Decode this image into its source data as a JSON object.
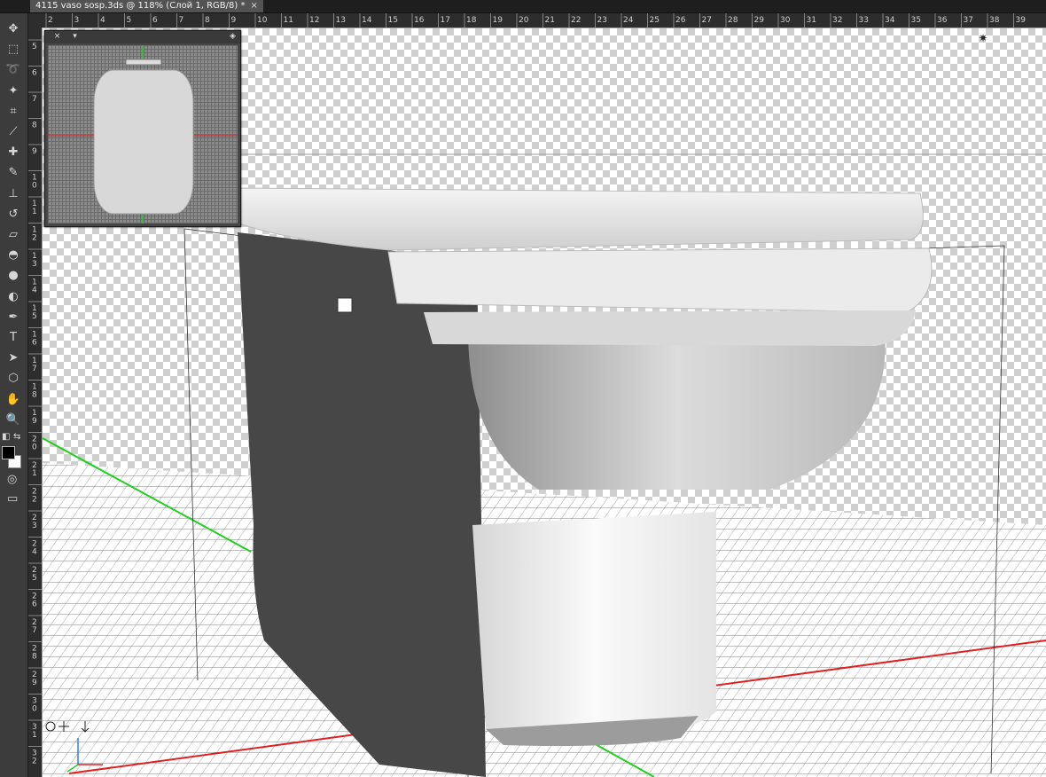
{
  "document": {
    "tab_title": "4115 vaso sosp.3ds @ 118% (Слой 1, RGB/8) *",
    "close_glyph": "×"
  },
  "ruler_top": {
    "ticks": [
      "2",
      "3",
      "4",
      "5",
      "6",
      "7",
      "8",
      "9",
      "10",
      "11",
      "12",
      "13",
      "14",
      "15",
      "16",
      "17",
      "18",
      "19",
      "20",
      "21",
      "22",
      "23",
      "24",
      "25",
      "26",
      "27",
      "28",
      "29",
      "30",
      "31",
      "32",
      "33",
      "34",
      "35",
      "36",
      "37",
      "38",
      "39"
    ]
  },
  "ruler_left": {
    "ticks": [
      "5",
      "6",
      "7",
      "8",
      "9",
      "10",
      "11",
      "12",
      "13",
      "14",
      "15",
      "16",
      "17",
      "18",
      "19",
      "20",
      "21",
      "22",
      "23",
      "24",
      "25",
      "26",
      "27",
      "28",
      "29",
      "30",
      "31",
      "32"
    ]
  },
  "toolbar": {
    "tools": [
      {
        "name": "move-tool",
        "glyph": "✥"
      },
      {
        "name": "marquee-tool",
        "glyph": "⬚"
      },
      {
        "name": "lasso-tool",
        "glyph": "➰"
      },
      {
        "name": "magic-wand-tool",
        "glyph": "✦"
      },
      {
        "name": "crop-tool",
        "glyph": "⌗"
      },
      {
        "name": "eyedropper-tool",
        "glyph": "⟋"
      },
      {
        "name": "healing-brush-tool",
        "glyph": "✚"
      },
      {
        "name": "brush-tool",
        "glyph": "✎"
      },
      {
        "name": "clone-stamp-tool",
        "glyph": "⊥"
      },
      {
        "name": "history-brush-tool",
        "glyph": "↺"
      },
      {
        "name": "eraser-tool",
        "glyph": "▱"
      },
      {
        "name": "paint-bucket-tool",
        "glyph": "◓"
      },
      {
        "name": "blur-tool",
        "glyph": "●"
      },
      {
        "name": "dodge-tool",
        "glyph": "◐"
      },
      {
        "name": "pen-tool",
        "glyph": "✒"
      },
      {
        "name": "type-tool",
        "glyph": "T"
      },
      {
        "name": "path-selection-tool",
        "glyph": "➤"
      },
      {
        "name": "shape-tool",
        "glyph": "⬡"
      },
      {
        "name": "hand-tool",
        "glyph": "✋"
      },
      {
        "name": "zoom-tool",
        "glyph": "🔍"
      }
    ],
    "default_colors_glyph": "◧",
    "swap_colors_glyph": "⇆",
    "foreground_color": "#000000",
    "background_color": "#ffffff",
    "quick_mask_glyph": "◎",
    "screen_mode_glyph": "▭"
  },
  "nav_panel": {
    "close_glyph": "×",
    "menu_glyph": "▾",
    "collapse_glyph": "◈"
  },
  "colors": {
    "axis_red": "#e02020",
    "axis_green": "#1fd01f",
    "guide_gold": "#c8a53a"
  }
}
